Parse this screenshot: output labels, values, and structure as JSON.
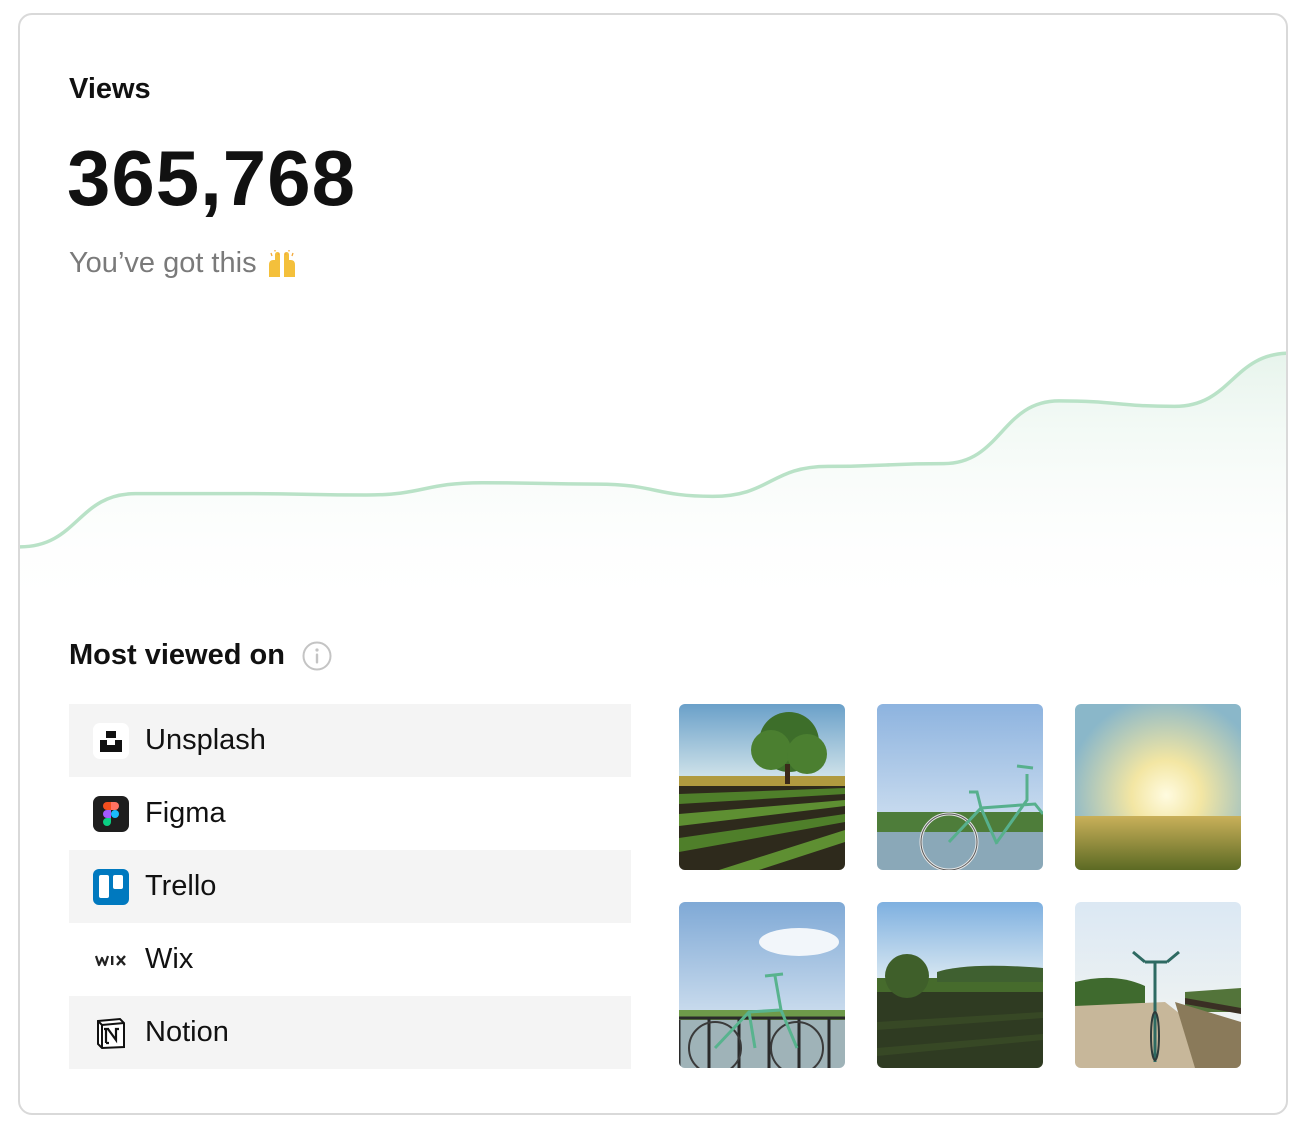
{
  "views": {
    "label": "Views",
    "value": "365,768",
    "subtitle": "You’ve got this",
    "subtitle_emoji": "raising-hands-emoji"
  },
  "chart_data": {
    "type": "area",
    "title": "",
    "xlabel": "",
    "ylabel": "",
    "grid": false,
    "line_color": "#b9e2c7",
    "fill_color": "#eef7f1",
    "x": [
      0,
      1,
      2,
      3,
      4,
      5,
      6,
      7,
      8,
      9,
      10,
      11
    ],
    "values": [
      50,
      89,
      89,
      88,
      97,
      96,
      87,
      109,
      111,
      157,
      153,
      192
    ],
    "ylim": [
      0,
      220
    ]
  },
  "most_viewed": {
    "title": "Most viewed on",
    "info_icon": "info-icon",
    "items": [
      {
        "label": "Unsplash",
        "icon": "unsplash-logo-icon"
      },
      {
        "label": "Figma",
        "icon": "figma-logo-icon"
      },
      {
        "label": "Trello",
        "icon": "trello-logo-icon"
      },
      {
        "label": "Wix",
        "icon": "wix-logo-icon"
      },
      {
        "label": "Notion",
        "icon": "notion-logo-icon"
      }
    ]
  },
  "photos": [
    {
      "subject": "crop field with tree"
    },
    {
      "subject": "green bicycle by lake"
    },
    {
      "subject": "sunset over meadow"
    },
    {
      "subject": "bicycle on bridge"
    },
    {
      "subject": "green field with trees"
    },
    {
      "subject": "bicycle on dirt road"
    }
  ],
  "colors": {
    "accent_line": "#b9e2c7",
    "row_shade": "#f4f4f4",
    "muted_text": "#7a7a7a",
    "card_border": "#d9d9d9"
  }
}
